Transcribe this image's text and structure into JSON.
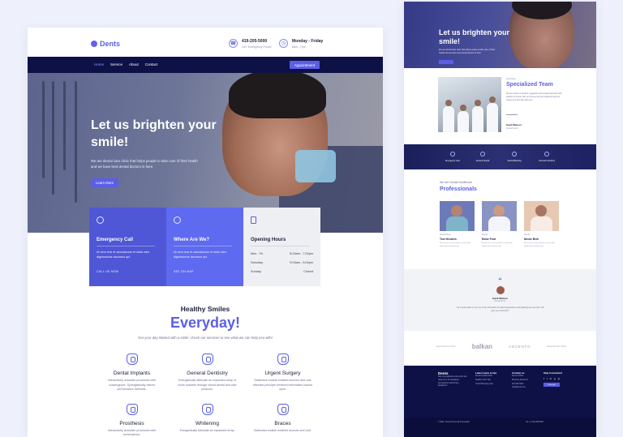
{
  "left": {
    "logo": "Dents",
    "contact_phone": {
      "main": "419-205-5000",
      "sub": "24/7 Emergency Phone"
    },
    "contact_hours": {
      "main": "Monday - Friday",
      "sub": "8am - 7pm"
    },
    "nav": [
      "Home",
      "Service",
      "About",
      "Contact"
    ],
    "appointment": "Appointment",
    "hero": {
      "title": "Let us brighten your smile!",
      "text": "We are dental care clinic that helps people to take care of their health and we have best dental doctors in here.",
      "button": "Learn More"
    },
    "cards": [
      {
        "title": "Emergency Call",
        "text": "At vero eos et accusamus et iusto odio dignissimos ducimus qui",
        "link": "CALL US NOW"
      },
      {
        "title": "Where Are We?",
        "text": "At vero eos et accusamus et iusto odio dignissimos ducimus qui",
        "link": "SEE ON MAP"
      }
    ],
    "hours": {
      "title": "Opening Hours",
      "rows": [
        {
          "day": "Mon - Fri",
          "time": "8:00am - 7:00pm"
        },
        {
          "day": "Saturday",
          "time": "9:00am - 5:00pm"
        },
        {
          "day": "Sunday",
          "time": "Closed"
        }
      ]
    },
    "section": {
      "title": "Healthy Smiles",
      "highlight": "Everyday!",
      "subtitle": "Get your day started with a smile: check our services to see what we can help you with!"
    },
    "services": [
      {
        "name": "Dental Implants",
        "desc": "Interactively actualize processes with convergence. Synergistically deliver performance methods."
      },
      {
        "name": "General Dentistry",
        "desc": "Energistically fabricate an expanded array of niche markets through robust dental and care products."
      },
      {
        "name": "Urgent Surgery",
        "desc": "Distinctive enable enabled sources and cost effective principle centered information placed upon."
      },
      {
        "name": "Prosthesis",
        "desc": "Interactively actualize processes with convergence."
      },
      {
        "name": "Whitening",
        "desc": "Energistically fabricate an expanded array."
      },
      {
        "name": "Braces",
        "desc": "Distinctive enable enabled sources and cost."
      }
    ]
  },
  "right": {
    "hero": {
      "title": "Let us brighten your smile!",
      "text": "We are dental care clinic that helps people to take care of their health and we have best dental doctors in here."
    },
    "team": {
      "sub": "DentCare",
      "title": "Specialized Team",
      "text": "We are a team of dentists, hygienists and receptionists who work together to ensure that you receive the best treatment that you require at a time that suits you.",
      "name": "Gavil Watson",
      "role": "Dental Doctor"
    },
    "band": [
      "Emergency Care",
      "General Dentist",
      "Teeth Whitening",
      "Cosmetic Dentistry"
    ],
    "pro": {
      "sub": "We are Dental Healthcare",
      "title": "Professionals",
      "doctors": [
        {
          "role": "Dental Doctor",
          "name": "Tom Henders",
          "text": "At vero eos et accusamus et iusto odio dignissimos ducimus qui."
        },
        {
          "role": "Dentist",
          "name": "Rowe Ford",
          "text": "At vero eos et accusamus et iusto odio dignissimos ducimus qui."
        },
        {
          "role": "Dentist",
          "name": "Nicole Berk",
          "text": "At vero eos et accusamus et iusto odio dignissimos ducimus qui."
        }
      ]
    },
    "testimonial": {
      "quote": "“",
      "name": "Gavil Watson",
      "role": "Dental Doctor",
      "text": "\"As a loyal reader to you one of the information it's delivering pleasure and pleasing auto see and i will give you a reminder\""
    },
    "logos": {
      "small1": "Ekta Dental Clinic",
      "balkan": "balkan",
      "advent": "ADVENTO",
      "small2": "Ekta Dental Clinic"
    },
    "footer": {
      "logo": "Dents",
      "about": "Sed ut perspiciatis unde omnis iste natus error sit voluptatem accusantium doloremque laudantium.",
      "news_head": "Latest news & tips",
      "news": [
        "Dental Implant Plans",
        "Healthy Teeth Tips",
        "Teeth Whitening Care"
      ],
      "contact_head": "Contact us",
      "contact": [
        "Service Office",
        "Business Dental St.",
        "419-205-5000",
        "info@dents.com"
      ],
      "stay_head": "Stay Connected",
      "social": [
        "f",
        "t",
        "in",
        "g",
        "yt"
      ],
      "subscribe": "Subscribe",
      "copy_left": "© 2022 - Dents Theme By Themeable",
      "copy_right": "Tel: +1 419-205-5000"
    }
  }
}
